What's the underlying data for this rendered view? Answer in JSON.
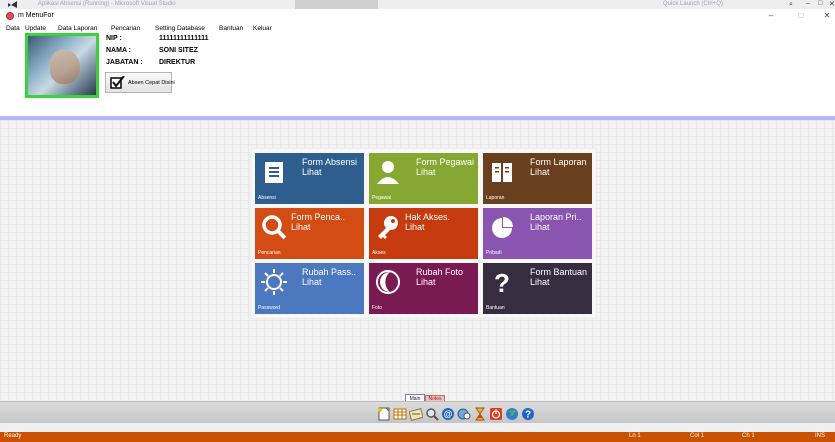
{
  "vs": {
    "title": "Aplikasi Absensi (Running) - Microsoft Visual Studio",
    "quick_launch": "Quick Launch (Ctrl+Q)",
    "min": "–",
    "max": "□",
    "close": "✕"
  },
  "window": {
    "title": "m MenuFor",
    "min": "–",
    "max": "□",
    "close": "✕"
  },
  "menu": [
    "Data",
    "Update",
    "Data Laporan",
    "Pencarian",
    "Setting Database",
    "Bantuan",
    "Keluar"
  ],
  "profile": {
    "nip_label": "NIP :",
    "nip_value": "11111111111111",
    "nama_label": "NAMA :",
    "nama_value": "SONI SITEZ",
    "jabatan_label": "JABATAN :",
    "jabatan_value": "DIREKTUR",
    "absen_button": "Absen Cepat Disini"
  },
  "tiles": [
    {
      "title": "Form Absensi",
      "sub": "Lihat",
      "footer": "Absensi",
      "color": "#2d5e8e",
      "icon": "document-icon"
    },
    {
      "title": "Form Pegawai",
      "sub": "Lihat",
      "footer": "Pegawai",
      "color": "#86a832",
      "icon": "person-icon"
    },
    {
      "title": "Form Laporan",
      "sub": "Lihat",
      "footer": "Laporan",
      "color": "#6a3f1e",
      "icon": "book-icon"
    },
    {
      "title": "Form Penca..",
      "sub": "Lihat",
      "footer": "Pencarian",
      "color": "#d24c14",
      "icon": "search-icon"
    },
    {
      "title": "Hak Akses.",
      "sub": "Lihat",
      "footer": "Akses",
      "color": "#c63b0e",
      "icon": "key-icon"
    },
    {
      "title": "Laporan Pri..",
      "sub": "Lihat",
      "footer": "Pribadi",
      "color": "#8a55b0",
      "icon": "pie-chart-icon"
    },
    {
      "title": "Rubah Pass..",
      "sub": "Lihat",
      "footer": "Password",
      "color": "#4c78c0",
      "icon": "sun-icon"
    },
    {
      "title": "Rubah Foto",
      "sub": "Lihat",
      "footer": "Foto",
      "color": "#7a1a52",
      "icon": "moon-icon"
    },
    {
      "title": "Form Bantuan",
      "sub": "Lihat",
      "footer": "Bantuan",
      "color": "#372d40",
      "icon": "question-icon"
    }
  ],
  "bottom_tabs": {
    "main": "Main",
    "notes": "Notes"
  },
  "toolbar_icons": [
    "new-file-icon",
    "table-icon",
    "notes-icon",
    "search-icon",
    "at-sign-icon",
    "globe-search-icon",
    "hourglass-icon",
    "power-icon",
    "globe-icon",
    "help-icon"
  ],
  "status": {
    "left": "Ready",
    "ln": "Ln 1",
    "col": "Col 1",
    "ch": "Ch 1",
    "ins": "INS"
  }
}
